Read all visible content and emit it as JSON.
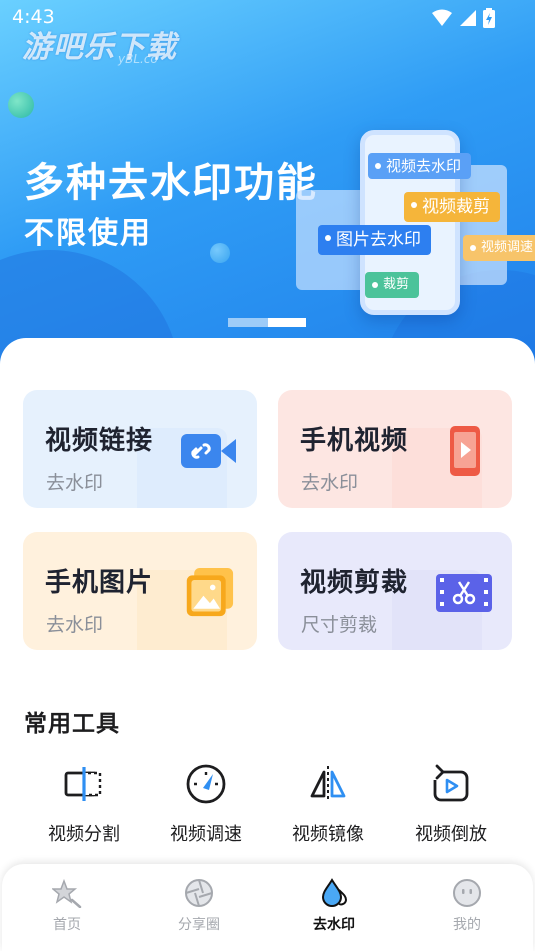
{
  "status": {
    "time": "4:43"
  },
  "watermark": {
    "main": "游吧乐下载",
    "sub": "yBL.co"
  },
  "banner": {
    "title": "多种去水印功能",
    "subtitle": "不限使用",
    "tags": [
      "视频去水印",
      "视频裁剪",
      "图片去水印",
      "视频调速",
      "裁剪"
    ],
    "active_slide_index": 1,
    "slide_count": 2
  },
  "feature_cards": [
    {
      "title": "视频链接",
      "subtitle": "去水印",
      "icon": "video-link-icon",
      "color": "#e6f1fd"
    },
    {
      "title": "手机视频",
      "subtitle": "去水印",
      "icon": "phone-video-icon",
      "color": "#fde6e2"
    },
    {
      "title": "手机图片",
      "subtitle": "去水印",
      "icon": "phone-image-icon",
      "color": "#fff1dd"
    },
    {
      "title": "视频剪裁",
      "subtitle": "尺寸剪裁",
      "icon": "video-crop-icon",
      "color": "#e8e9fb"
    }
  ],
  "tools": {
    "title": "常用工具",
    "items": [
      {
        "label": "视频分割",
        "icon": "split-icon"
      },
      {
        "label": "视频调速",
        "icon": "speed-icon"
      },
      {
        "label": "视频镜像",
        "icon": "mirror-icon"
      },
      {
        "label": "视频倒放",
        "icon": "reverse-icon"
      }
    ]
  },
  "tabbar": {
    "items": [
      {
        "label": "首页",
        "icon": "home-star-icon"
      },
      {
        "label": "分享圈",
        "icon": "aperture-icon"
      },
      {
        "label": "去水印",
        "icon": "water-drop-icon",
        "active": true
      },
      {
        "label": "我的",
        "icon": "profile-face-icon"
      }
    ]
  },
  "colors": {
    "accent": "#2f8ff2",
    "banner_start": "#6ad0ff",
    "banner_end": "#1f7fea"
  }
}
